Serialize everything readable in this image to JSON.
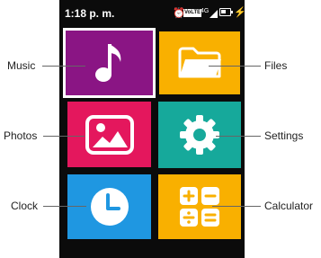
{
  "status_bar": {
    "time": "1:18 p. m.",
    "alarm_icon": "alarm-clock-icon",
    "volte_badge": "VoLTE",
    "network": "4G",
    "signal_icon": "signal-icon",
    "battery_icon": "battery-icon",
    "charging_icon": "charging-bolt-icon"
  },
  "tiles": [
    {
      "id": "music",
      "label": "Music",
      "icon": "music-note-icon",
      "color": "#8a1584",
      "selected": true
    },
    {
      "id": "files",
      "label": "Files",
      "icon": "folder-icon",
      "color": "#f9b000"
    },
    {
      "id": "photos",
      "label": "Photos",
      "icon": "image-icon",
      "color": "#e4175d"
    },
    {
      "id": "settings",
      "label": "Settings",
      "icon": "gear-icon",
      "color": "#16a99b"
    },
    {
      "id": "clock",
      "label": "Clock",
      "icon": "clock-icon",
      "color": "#1f97e1"
    },
    {
      "id": "calculator",
      "label": "Calculator",
      "icon": "calculator-icon",
      "color": "#f9b000"
    }
  ],
  "callouts": {
    "music": "Music",
    "files": "Files",
    "photos": "Photos",
    "settings": "Settings",
    "clock": "Clock",
    "calculator": "Calculator"
  },
  "colors": {
    "screen_background": "#0b0b0b",
    "selection_border": "#ffffff"
  }
}
